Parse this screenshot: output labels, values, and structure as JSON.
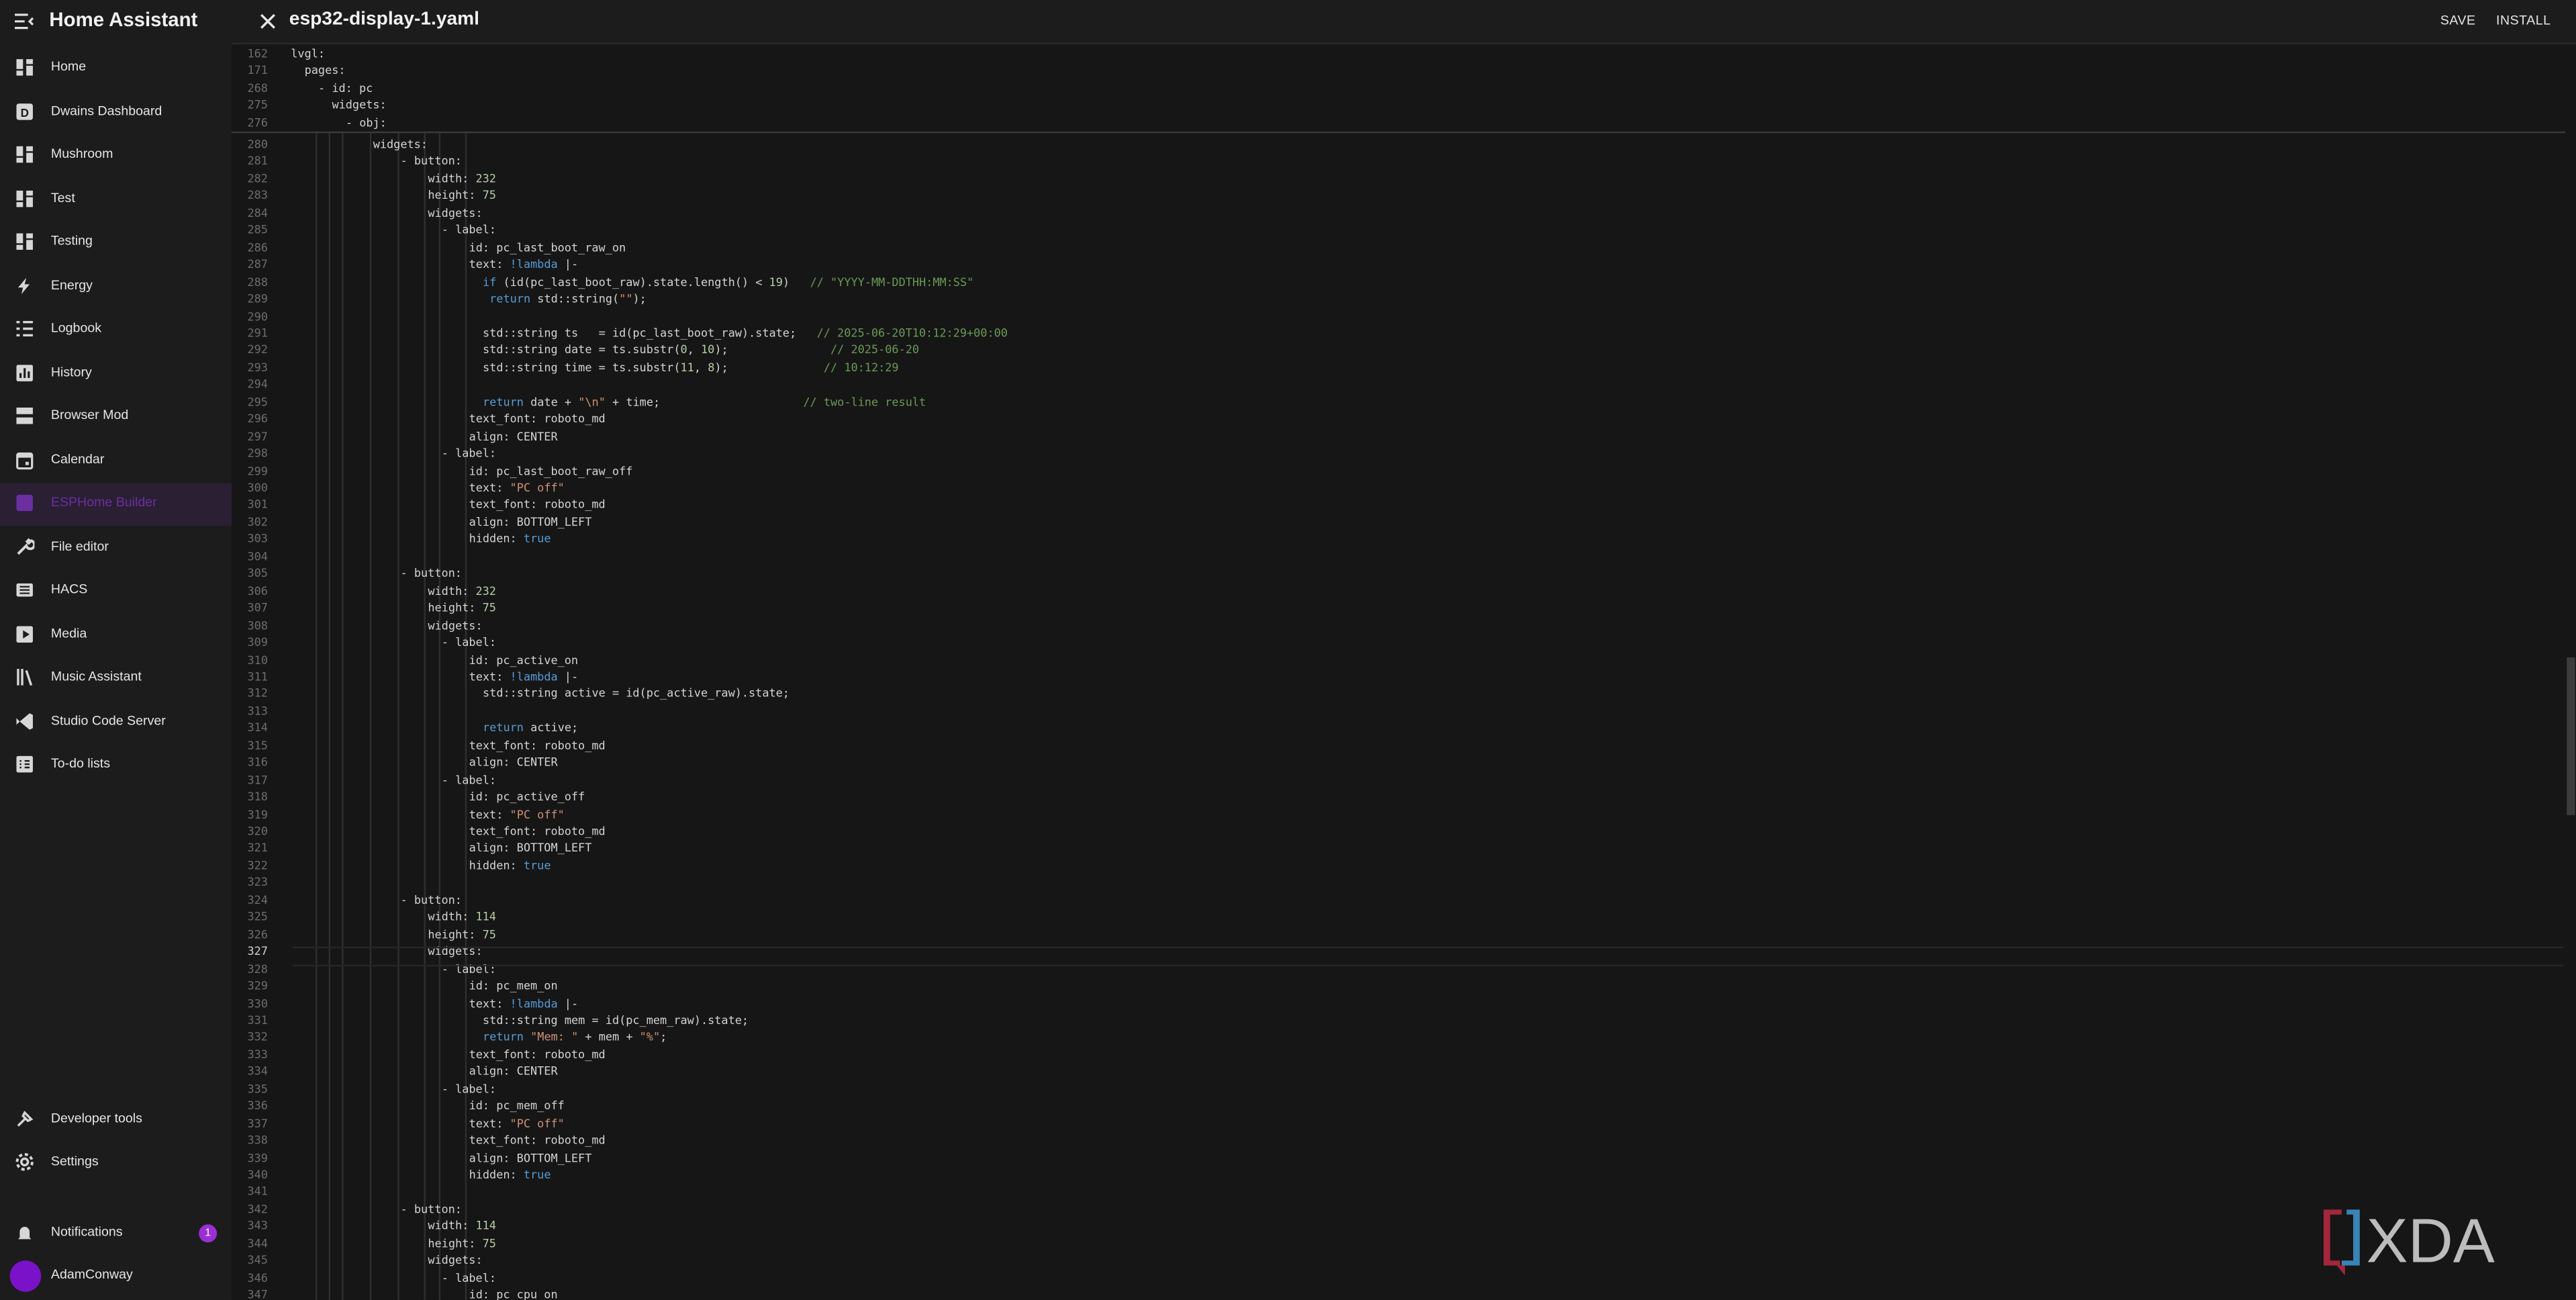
{
  "app": {
    "title": "Home Assistant"
  },
  "sidebar": {
    "items": [
      {
        "label": "Home",
        "icon": "dashboard-icon"
      },
      {
        "label": "Dwains Dashboard",
        "icon": "d-box-icon"
      },
      {
        "label": "Mushroom",
        "icon": "dashboard-icon"
      },
      {
        "label": "Test",
        "icon": "dashboard-icon"
      },
      {
        "label": "Testing",
        "icon": "dashboard-icon"
      },
      {
        "label": "Energy",
        "icon": "lightning-icon"
      },
      {
        "label": "Logbook",
        "icon": "list-icon"
      },
      {
        "label": "History",
        "icon": "chart-box-icon"
      },
      {
        "label": "Browser Mod",
        "icon": "server-icon"
      },
      {
        "label": "Calendar",
        "icon": "calendar-icon"
      },
      {
        "label": "ESPHome Builder",
        "icon": "esphome-icon",
        "active": true
      },
      {
        "label": "File editor",
        "icon": "wrench-icon"
      },
      {
        "label": "HACS",
        "icon": "hacs-icon"
      },
      {
        "label": "Media",
        "icon": "media-icon"
      },
      {
        "label": "Music Assistant",
        "icon": "library-icon"
      },
      {
        "label": "Studio Code Server",
        "icon": "vscode-icon"
      },
      {
        "label": "To-do lists",
        "icon": "checklist-icon"
      }
    ],
    "bottom": {
      "developer_tools": "Developer tools",
      "settings": "Settings",
      "notifications": "Notifications",
      "notifications_count": "1",
      "user": "AdamConway"
    }
  },
  "header": {
    "file_name": "esp32-display-1.yaml",
    "save": "SAVE",
    "install": "INSTALL"
  },
  "editor": {
    "current_line": 327,
    "sticky_lines": [
      {
        "n": 162,
        "indent": 0,
        "t": [
          [
            "k",
            "lvgl:"
          ]
        ]
      },
      {
        "n": 171,
        "indent": 1,
        "t": [
          [
            "k",
            "pages:"
          ]
        ]
      },
      {
        "n": 268,
        "indent": 2,
        "t": [
          [
            "k",
            "- id: pc"
          ]
        ]
      },
      {
        "n": 275,
        "indent": 3,
        "t": [
          [
            "k",
            "widgets:"
          ]
        ]
      },
      {
        "n": 276,
        "indent": 4,
        "t": [
          [
            "k",
            "- obj:"
          ]
        ]
      }
    ],
    "lines": [
      {
        "n": 280,
        "indent": 6,
        "t": [
          [
            "k",
            "widgets:"
          ]
        ]
      },
      {
        "n": 281,
        "indent": 8,
        "t": [
          [
            "k",
            "- button:"
          ]
        ]
      },
      {
        "n": 282,
        "indent": 10,
        "t": [
          [
            "k",
            "width: "
          ],
          [
            "n",
            "232"
          ]
        ]
      },
      {
        "n": 283,
        "indent": 10,
        "t": [
          [
            "k",
            "height: "
          ],
          [
            "n",
            "75"
          ]
        ]
      },
      {
        "n": 284,
        "indent": 10,
        "t": [
          [
            "k",
            "widgets:"
          ]
        ]
      },
      {
        "n": 285,
        "indent": 11,
        "t": [
          [
            "k",
            "- label:"
          ]
        ]
      },
      {
        "n": 286,
        "indent": 13,
        "t": [
          [
            "k",
            "id: pc_last_boot_raw_on"
          ]
        ]
      },
      {
        "n": 287,
        "indent": 13,
        "t": [
          [
            "k",
            "text: "
          ],
          [
            "b",
            "!lambda"
          ],
          [
            "k",
            " |-"
          ]
        ]
      },
      {
        "n": 288,
        "indent": 14,
        "t": [
          [
            "b",
            "if"
          ],
          [
            "k",
            " (id(pc_last_boot_raw).state.length() < "
          ],
          [
            "n",
            "19"
          ],
          [
            "k",
            ")   "
          ],
          [
            "c",
            "// \"YYYY-MM-DDTHH:MM:SS\""
          ]
        ]
      },
      {
        "n": 289,
        "indent": 14,
        "t": [
          [
            "k",
            " "
          ],
          [
            "b",
            "return"
          ],
          [
            "k",
            " std::string("
          ],
          [
            "s",
            "\"\""
          ],
          [
            "k",
            ");"
          ]
        ]
      },
      {
        "n": 290,
        "indent": 0,
        "t": []
      },
      {
        "n": 291,
        "indent": 14,
        "t": [
          [
            "k",
            "std::string ts   = id(pc_last_boot_raw).state;   "
          ],
          [
            "c",
            "// 2025-06-20T10:12:29+00:00"
          ]
        ]
      },
      {
        "n": 292,
        "indent": 14,
        "t": [
          [
            "k",
            "std::string date = ts.substr("
          ],
          [
            "n",
            "0"
          ],
          [
            "k",
            ", "
          ],
          [
            "n",
            "10"
          ],
          [
            "k",
            ");               "
          ],
          [
            "c",
            "// 2025-06-20"
          ]
        ]
      },
      {
        "n": 293,
        "indent": 14,
        "t": [
          [
            "k",
            "std::string time = ts.substr("
          ],
          [
            "n",
            "11"
          ],
          [
            "k",
            ", "
          ],
          [
            "n",
            "8"
          ],
          [
            "k",
            ");              "
          ],
          [
            "c",
            "// 10:12:29"
          ]
        ]
      },
      {
        "n": 294,
        "indent": 0,
        "t": []
      },
      {
        "n": 295,
        "indent": 14,
        "t": [
          [
            "b",
            "return"
          ],
          [
            "k",
            " date + "
          ],
          [
            "s",
            "\"\\n\""
          ],
          [
            "k",
            " + time;                     "
          ],
          [
            "c",
            "// two-line result"
          ]
        ]
      },
      {
        "n": 296,
        "indent": 13,
        "t": [
          [
            "k",
            "text_font: roboto_md"
          ]
        ]
      },
      {
        "n": 297,
        "indent": 13,
        "t": [
          [
            "k",
            "align: CENTER"
          ]
        ]
      },
      {
        "n": 298,
        "indent": 11,
        "t": [
          [
            "k",
            "- label:"
          ]
        ]
      },
      {
        "n": 299,
        "indent": 13,
        "t": [
          [
            "k",
            "id: pc_last_boot_raw_off"
          ]
        ]
      },
      {
        "n": 300,
        "indent": 13,
        "t": [
          [
            "k",
            "text: "
          ],
          [
            "s",
            "\"PC off\""
          ]
        ]
      },
      {
        "n": 301,
        "indent": 13,
        "t": [
          [
            "k",
            "text_font: roboto_md"
          ]
        ]
      },
      {
        "n": 302,
        "indent": 13,
        "t": [
          [
            "k",
            "align: BOTTOM_LEFT"
          ]
        ]
      },
      {
        "n": 303,
        "indent": 13,
        "t": [
          [
            "k",
            "hidden: "
          ],
          [
            "b",
            "true"
          ]
        ]
      },
      {
        "n": 304,
        "indent": 0,
        "t": []
      },
      {
        "n": 305,
        "indent": 8,
        "t": [
          [
            "k",
            "- button:"
          ]
        ]
      },
      {
        "n": 306,
        "indent": 10,
        "t": [
          [
            "k",
            "width: "
          ],
          [
            "n",
            "232"
          ]
        ]
      },
      {
        "n": 307,
        "indent": 10,
        "t": [
          [
            "k",
            "height: "
          ],
          [
            "n",
            "75"
          ]
        ]
      },
      {
        "n": 308,
        "indent": 10,
        "t": [
          [
            "k",
            "widgets:"
          ]
        ]
      },
      {
        "n": 309,
        "indent": 11,
        "t": [
          [
            "k",
            "- label:"
          ]
        ]
      },
      {
        "n": 310,
        "indent": 13,
        "t": [
          [
            "k",
            "id: pc_active_on"
          ]
        ]
      },
      {
        "n": 311,
        "indent": 13,
        "t": [
          [
            "k",
            "text: "
          ],
          [
            "b",
            "!lambda"
          ],
          [
            "k",
            " |-"
          ]
        ]
      },
      {
        "n": 312,
        "indent": 14,
        "t": [
          [
            "k",
            "std::string active = id(pc_active_raw).state;"
          ]
        ]
      },
      {
        "n": 313,
        "indent": 0,
        "t": []
      },
      {
        "n": 314,
        "indent": 14,
        "t": [
          [
            "b",
            "return"
          ],
          [
            "k",
            " active;"
          ]
        ]
      },
      {
        "n": 315,
        "indent": 13,
        "t": [
          [
            "k",
            "text_font: roboto_md"
          ]
        ]
      },
      {
        "n": 316,
        "indent": 13,
        "t": [
          [
            "k",
            "align: CENTER"
          ]
        ]
      },
      {
        "n": 317,
        "indent": 11,
        "t": [
          [
            "k",
            "- label:"
          ]
        ]
      },
      {
        "n": 318,
        "indent": 13,
        "t": [
          [
            "k",
            "id: pc_active_off"
          ]
        ]
      },
      {
        "n": 319,
        "indent": 13,
        "t": [
          [
            "k",
            "text: "
          ],
          [
            "s",
            "\"PC off\""
          ]
        ]
      },
      {
        "n": 320,
        "indent": 13,
        "t": [
          [
            "k",
            "text_font: roboto_md"
          ]
        ]
      },
      {
        "n": 321,
        "indent": 13,
        "t": [
          [
            "k",
            "align: BOTTOM_LEFT"
          ]
        ]
      },
      {
        "n": 322,
        "indent": 13,
        "t": [
          [
            "k",
            "hidden: "
          ],
          [
            "b",
            "true"
          ]
        ]
      },
      {
        "n": 323,
        "indent": 0,
        "t": []
      },
      {
        "n": 324,
        "indent": 8,
        "t": [
          [
            "k",
            "- button:"
          ]
        ]
      },
      {
        "n": 325,
        "indent": 10,
        "t": [
          [
            "k",
            "width: "
          ],
          [
            "n",
            "114"
          ]
        ]
      },
      {
        "n": 326,
        "indent": 10,
        "t": [
          [
            "k",
            "height: "
          ],
          [
            "n",
            "75"
          ]
        ]
      },
      {
        "n": 327,
        "indent": 10,
        "t": [
          [
            "k",
            "widgets:"
          ]
        ]
      },
      {
        "n": 328,
        "indent": 11,
        "t": [
          [
            "k",
            "- label:"
          ]
        ]
      },
      {
        "n": 329,
        "indent": 13,
        "t": [
          [
            "k",
            "id: pc_mem_on"
          ]
        ]
      },
      {
        "n": 330,
        "indent": 13,
        "t": [
          [
            "k",
            "text: "
          ],
          [
            "b",
            "!lambda"
          ],
          [
            "k",
            " |-"
          ]
        ]
      },
      {
        "n": 331,
        "indent": 14,
        "t": [
          [
            "k",
            "std::string mem = id(pc_mem_raw).state;"
          ]
        ]
      },
      {
        "n": 332,
        "indent": 14,
        "t": [
          [
            "b",
            "return"
          ],
          [
            "k",
            " "
          ],
          [
            "s",
            "\"Mem: \""
          ],
          [
            "k",
            " + mem + "
          ],
          [
            "s",
            "\"%\""
          ],
          [
            "k",
            ";"
          ]
        ]
      },
      {
        "n": 333,
        "indent": 13,
        "t": [
          [
            "k",
            "text_font: roboto_md"
          ]
        ]
      },
      {
        "n": 334,
        "indent": 13,
        "t": [
          [
            "k",
            "align: CENTER"
          ]
        ]
      },
      {
        "n": 335,
        "indent": 11,
        "t": [
          [
            "k",
            "- label:"
          ]
        ]
      },
      {
        "n": 336,
        "indent": 13,
        "t": [
          [
            "k",
            "id: pc_mem_off"
          ]
        ]
      },
      {
        "n": 337,
        "indent": 13,
        "t": [
          [
            "k",
            "text: "
          ],
          [
            "s",
            "\"PC off\""
          ]
        ]
      },
      {
        "n": 338,
        "indent": 13,
        "t": [
          [
            "k",
            "text_font: roboto_md"
          ]
        ]
      },
      {
        "n": 339,
        "indent": 13,
        "t": [
          [
            "k",
            "align: BOTTOM_LEFT"
          ]
        ]
      },
      {
        "n": 340,
        "indent": 13,
        "t": [
          [
            "k",
            "hidden: "
          ],
          [
            "b",
            "true"
          ]
        ]
      },
      {
        "n": 341,
        "indent": 0,
        "t": []
      },
      {
        "n": 342,
        "indent": 8,
        "t": [
          [
            "k",
            "- button:"
          ]
        ]
      },
      {
        "n": 343,
        "indent": 10,
        "t": [
          [
            "k",
            "width: "
          ],
          [
            "n",
            "114"
          ]
        ]
      },
      {
        "n": 344,
        "indent": 10,
        "t": [
          [
            "k",
            "height: "
          ],
          [
            "n",
            "75"
          ]
        ]
      },
      {
        "n": 345,
        "indent": 10,
        "t": [
          [
            "k",
            "widgets:"
          ]
        ]
      },
      {
        "n": 346,
        "indent": 11,
        "t": [
          [
            "k",
            "- label:"
          ]
        ]
      },
      {
        "n": 347,
        "indent": 13,
        "t": [
          [
            "k",
            "id: pc_cpu_on"
          ]
        ]
      }
    ]
  },
  "watermark": {
    "text": "XDA"
  },
  "colors": {
    "accent": "#7a12c9",
    "sidebar_bg": "#1c1c1c",
    "editor_bg": "#161616"
  }
}
